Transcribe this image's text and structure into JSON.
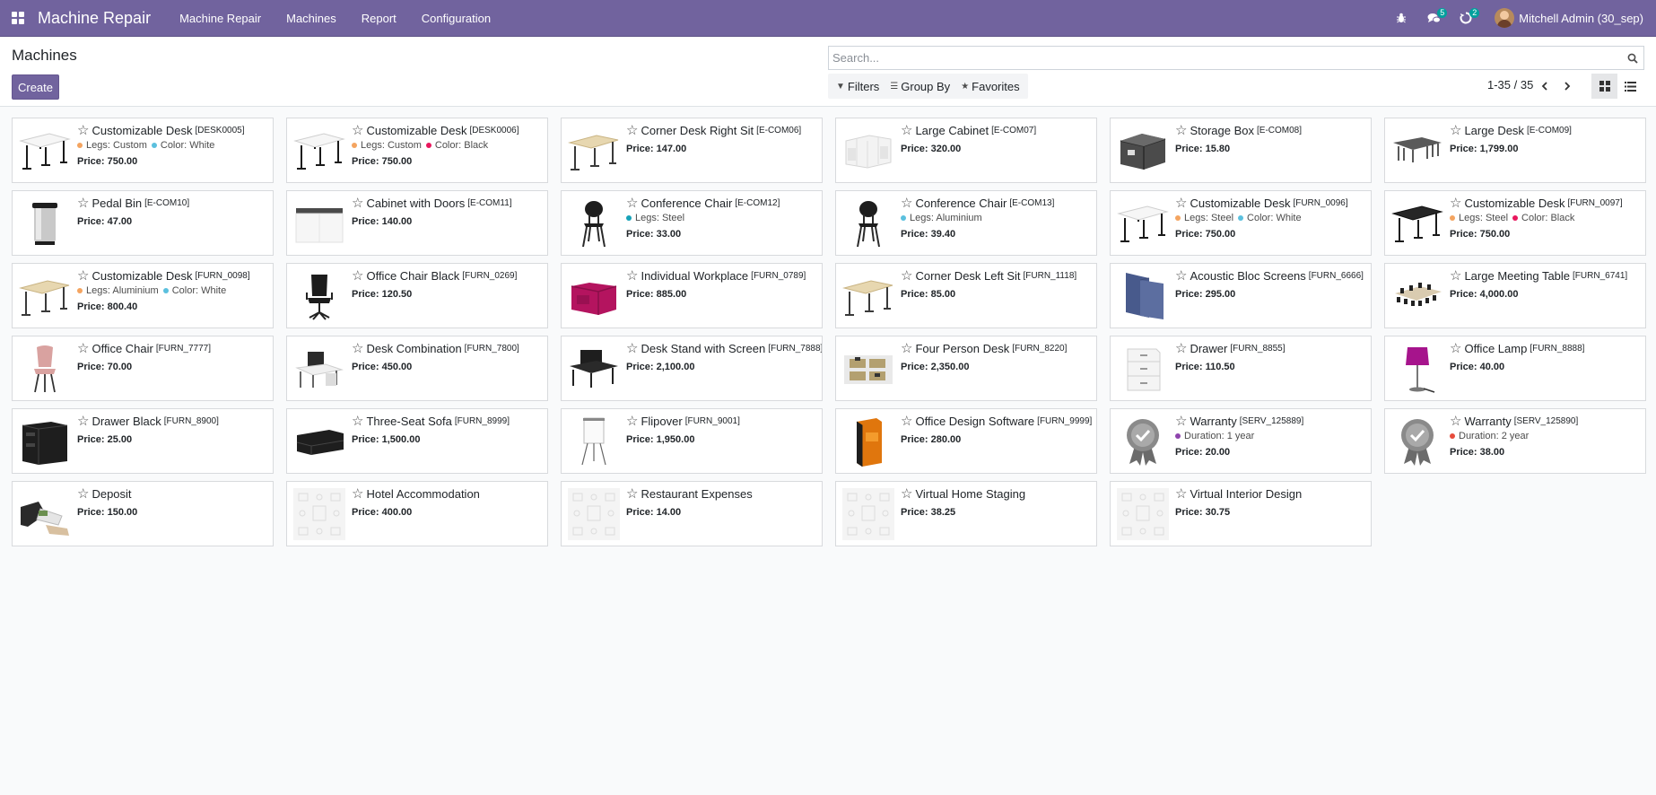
{
  "navbar": {
    "brand": "Machine Repair",
    "menu": [
      "Machine Repair",
      "Machines",
      "Report",
      "Configuration"
    ],
    "messages_count": "5",
    "activities_count": "2",
    "user": "Mitchell Admin (30_sep)"
  },
  "control": {
    "title": "Machines",
    "create_label": "Create",
    "search_placeholder": "Search...",
    "filters_label": "Filters",
    "groupby_label": "Group By",
    "favorites_label": "Favorites",
    "pager": "1-35 / 35"
  },
  "colors": {
    "brand": "#71639e",
    "badge": "#00a09d"
  },
  "cards": [
    {
      "name": "Customizable Desk",
      "code": "[DESK0005]",
      "price": "Price: 750.00",
      "img": "desk-white",
      "attrs": [
        {
          "label": "Legs: Custom",
          "color": "#f4a460"
        },
        {
          "label": "Color: White",
          "color": "#5bc0de"
        }
      ]
    },
    {
      "name": "Customizable Desk",
      "code": "[DESK0006]",
      "price": "Price: 750.00",
      "img": "desk-white",
      "attrs": [
        {
          "label": "Legs: Custom",
          "color": "#f4a460"
        },
        {
          "label": "Color: Black",
          "color": "#e8175d"
        }
      ]
    },
    {
      "name": "Corner Desk Right Sit",
      "code": "[E-COM06]",
      "price": "Price: 147.00",
      "img": "desk-wood",
      "attrs": []
    },
    {
      "name": "Large Cabinet",
      "code": "[E-COM07]",
      "price": "Price: 320.00",
      "img": "cabinet",
      "attrs": []
    },
    {
      "name": "Storage Box",
      "code": "[E-COM08]",
      "price": "Price: 15.80",
      "img": "box",
      "attrs": []
    },
    {
      "name": "Large Desk",
      "code": "[E-COM09]",
      "price": "Price: 1,799.00",
      "img": "large-desk",
      "attrs": []
    },
    {
      "name": "Pedal Bin",
      "code": "[E-COM10]",
      "price": "Price: 47.00",
      "img": "bin",
      "attrs": []
    },
    {
      "name": "Cabinet with Doors",
      "code": "[E-COM11]",
      "price": "Price: 140.00",
      "img": "cabinet-doors",
      "attrs": []
    },
    {
      "name": "Conference Chair",
      "code": "[E-COM12]",
      "price": "Price: 33.00",
      "img": "chair-black",
      "attrs": [
        {
          "label": "Legs: Steel",
          "color": "#17a2b8"
        }
      ]
    },
    {
      "name": "Conference Chair",
      "code": "[E-COM13]",
      "price": "Price: 39.40",
      "img": "chair-black",
      "attrs": [
        {
          "label": "Legs: Aluminium",
          "color": "#5bc0de"
        }
      ]
    },
    {
      "name": "Customizable Desk",
      "code": "[FURN_0096]",
      "price": "Price: 750.00",
      "img": "desk-white",
      "attrs": [
        {
          "label": "Legs: Steel",
          "color": "#f4a460"
        },
        {
          "label": "Color: White",
          "color": "#5bc0de"
        }
      ]
    },
    {
      "name": "Customizable Desk",
      "code": "[FURN_0097]",
      "price": "Price: 750.00",
      "img": "desk-black",
      "attrs": [
        {
          "label": "Legs: Steel",
          "color": "#f4a460"
        },
        {
          "label": "Color: Black",
          "color": "#e8175d"
        }
      ]
    },
    {
      "name": "Customizable Desk",
      "code": "[FURN_0098]",
      "price": "Price: 800.40",
      "img": "desk-wood",
      "attrs": [
        {
          "label": "Legs: Aluminium",
          "color": "#f4a460"
        },
        {
          "label": "Color: White",
          "color": "#5bc0de"
        }
      ]
    },
    {
      "name": "Office Chair Black",
      "code": "[FURN_0269]",
      "price": "Price: 120.50",
      "img": "office-chair-black",
      "attrs": []
    },
    {
      "name": "Individual Workplace",
      "code": "[FURN_0789]",
      "price": "Price: 885.00",
      "img": "workplace",
      "attrs": []
    },
    {
      "name": "Corner Desk Left Sit",
      "code": "[FURN_1118]",
      "price": "Price: 85.00",
      "img": "desk-wood",
      "attrs": []
    },
    {
      "name": "Acoustic Bloc Screens",
      "code": "[FURN_6666]",
      "price": "Price: 295.00",
      "img": "screens",
      "attrs": []
    },
    {
      "name": "Large Meeting Table",
      "code": "[FURN_6741]",
      "price": "Price: 4,000.00",
      "img": "meeting-table",
      "attrs": []
    },
    {
      "name": "Office Chair",
      "code": "[FURN_7777]",
      "price": "Price: 70.00",
      "img": "chair-pink",
      "attrs": []
    },
    {
      "name": "Desk Combination",
      "code": "[FURN_7800]",
      "price": "Price: 450.00",
      "img": "desk-combo",
      "attrs": []
    },
    {
      "name": "Desk Stand with Screen",
      "code": "[FURN_7888]",
      "price": "Price: 2,100.00",
      "img": "desk-screen",
      "attrs": []
    },
    {
      "name": "Four Person Desk",
      "code": "[FURN_8220]",
      "price": "Price: 2,350.00",
      "img": "four-desk",
      "attrs": []
    },
    {
      "name": "Drawer",
      "code": "[FURN_8855]",
      "price": "Price: 110.50",
      "img": "drawer",
      "attrs": []
    },
    {
      "name": "Office Lamp",
      "code": "[FURN_8888]",
      "price": "Price: 40.00",
      "img": "lamp",
      "attrs": []
    },
    {
      "name": "Drawer Black",
      "code": "[FURN_8900]",
      "price": "Price: 25.00",
      "img": "drawer-black",
      "attrs": []
    },
    {
      "name": "Three-Seat Sofa",
      "code": "[FURN_8999]",
      "price": "Price: 1,500.00",
      "img": "sofa",
      "attrs": []
    },
    {
      "name": "Flipover",
      "code": "[FURN_9001]",
      "price": "Price: 1,950.00",
      "img": "flipover",
      "attrs": []
    },
    {
      "name": "Office Design Software",
      "code": "[FURN_9999]",
      "price": "Price: 280.00",
      "img": "software",
      "attrs": []
    },
    {
      "name": "Warranty",
      "code": "[SERV_125889]",
      "price": "Price: 20.00",
      "img": "warranty",
      "attrs": [
        {
          "label": "Duration: 1 year",
          "color": "#8e44ad"
        }
      ]
    },
    {
      "name": "Warranty",
      "code": "[SERV_125890]",
      "price": "Price: 38.00",
      "img": "warranty",
      "attrs": [
        {
          "label": "Duration: 2 year",
          "color": "#e74c3c"
        }
      ]
    },
    {
      "name": "Deposit",
      "code": "",
      "price": "Price: 150.00",
      "img": "deposit",
      "attrs": []
    },
    {
      "name": "Hotel Accommodation",
      "code": "",
      "price": "Price: 400.00",
      "img": "placeholder",
      "attrs": []
    },
    {
      "name": "Restaurant Expenses",
      "code": "",
      "price": "Price: 14.00",
      "img": "placeholder",
      "attrs": []
    },
    {
      "name": "Virtual Home Staging",
      "code": "",
      "price": "Price: 38.25",
      "img": "placeholder",
      "attrs": []
    },
    {
      "name": "Virtual Interior Design",
      "code": "",
      "price": "Price: 30.75",
      "img": "placeholder",
      "attrs": []
    }
  ]
}
